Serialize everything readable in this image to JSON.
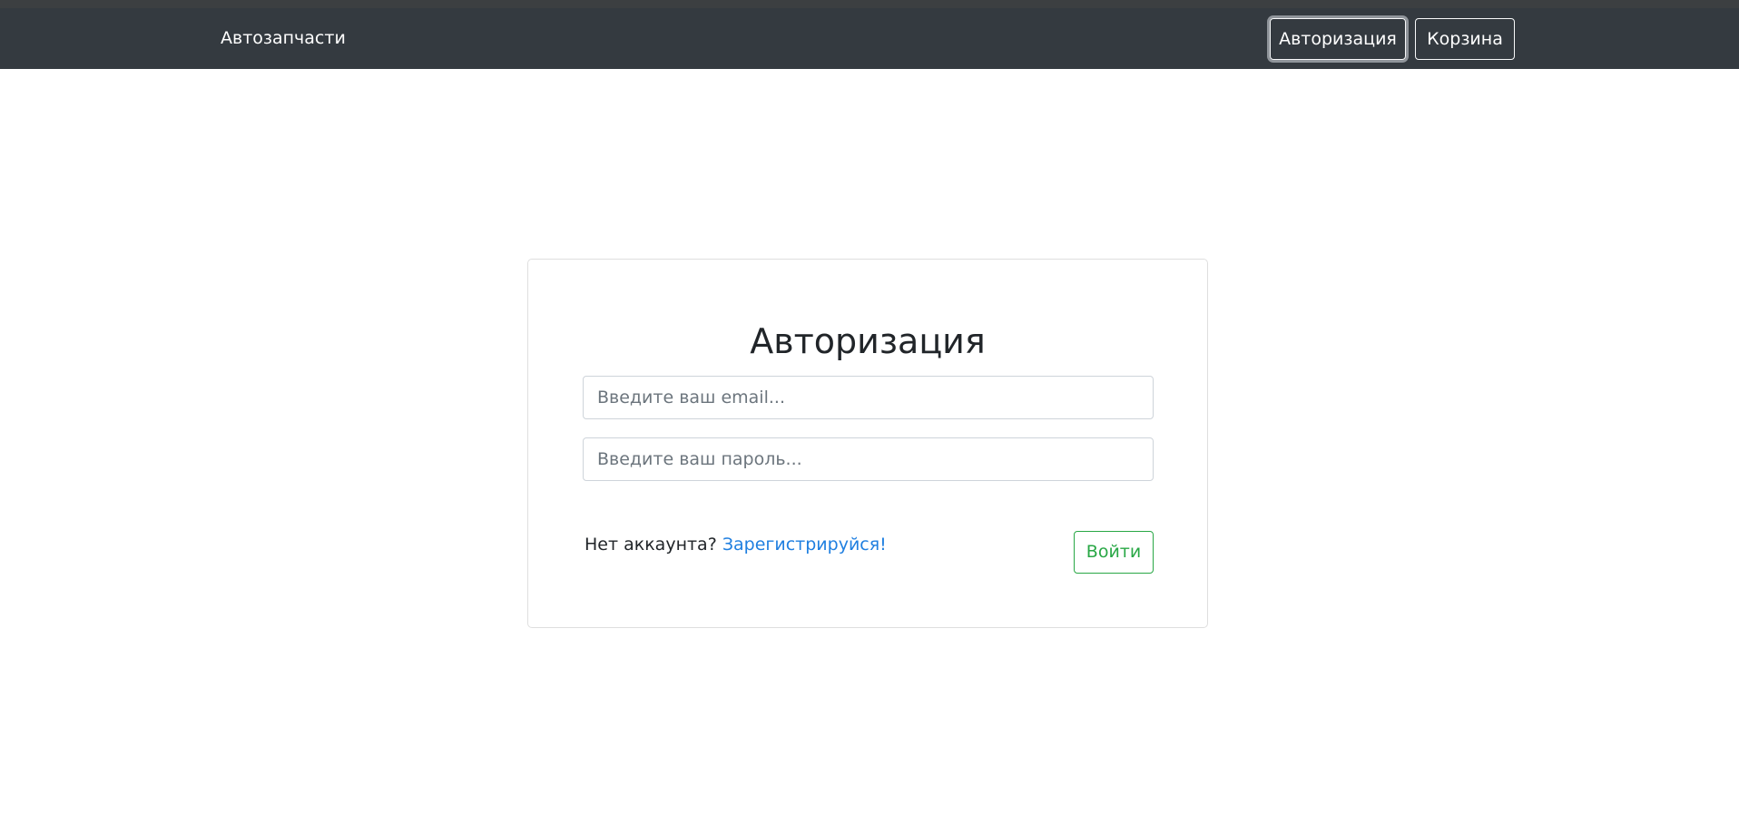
{
  "navbar": {
    "brand": "Автозапчасти",
    "auth_button": "Авторизация",
    "cart_button": "Корзина"
  },
  "login_card": {
    "title": "Авторизация",
    "email_placeholder": "Введите ваш email...",
    "password_placeholder": "Введите ваш пароль...",
    "no_account_text": "Нет аккаунта? ",
    "signup_link": "Зарегистрируйся!",
    "submit_button": "Войти"
  },
  "colors": {
    "navbar_bg": "#343a40",
    "link": "#1f7fe0",
    "success": "#28a745"
  }
}
